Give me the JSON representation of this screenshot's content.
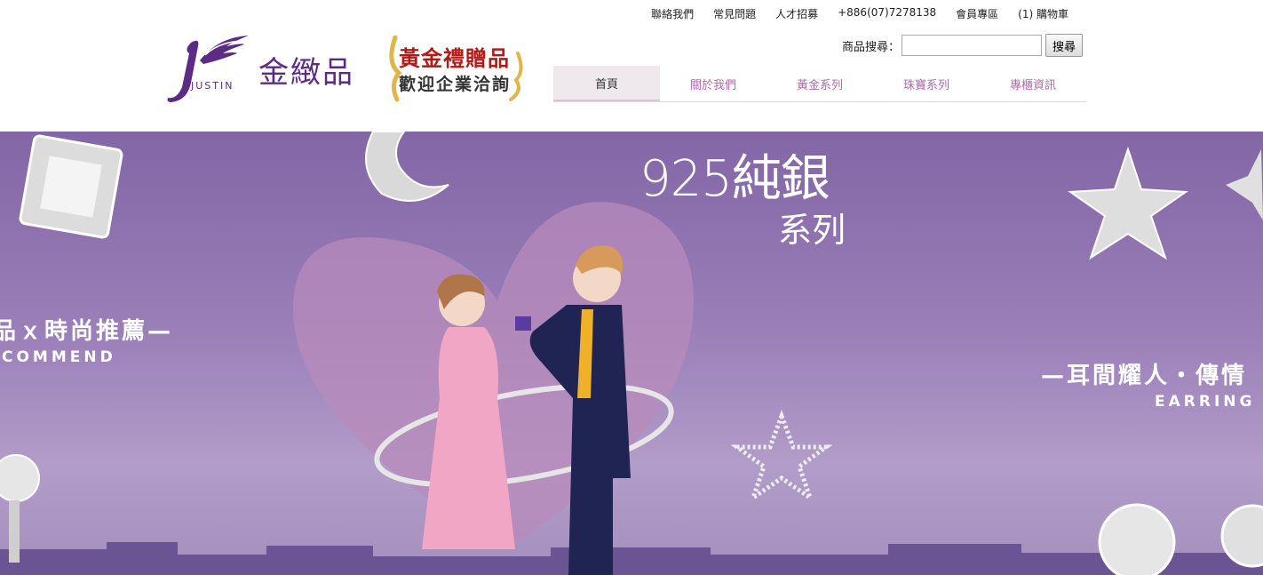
{
  "topbar": {
    "links": [
      "聯絡我們",
      "常見問題",
      "人才招募",
      "+886(07)7278138",
      "會員專區",
      "(1) 購物車"
    ]
  },
  "logo": {
    "brand_text": "JUSTIN",
    "name": "金緻品"
  },
  "promo": {
    "line1": "黃金禮贈品",
    "line2": "歡迎企業洽詢"
  },
  "search": {
    "label": "商品搜尋：",
    "placeholder": "",
    "value": "",
    "button": "搜尋"
  },
  "nav": {
    "items": [
      "首頁",
      "關於我們",
      "黃金系列",
      "珠寶系列",
      "專櫃資訊"
    ],
    "active": 0
  },
  "banner": {
    "title": "925純銀",
    "subtitle": "系列",
    "left_text_1": "品ｘ時尚推薦—",
    "left_text_2": "COMMEND",
    "right_text_1": "—耳間耀人・傳情",
    "right_text_2": "EARRING"
  },
  "colors": {
    "brand_purple": "#5b2b85",
    "nav_text": "#b06aa7",
    "banner_bg": "#8266a6",
    "promo_red": "#b21a1a"
  }
}
